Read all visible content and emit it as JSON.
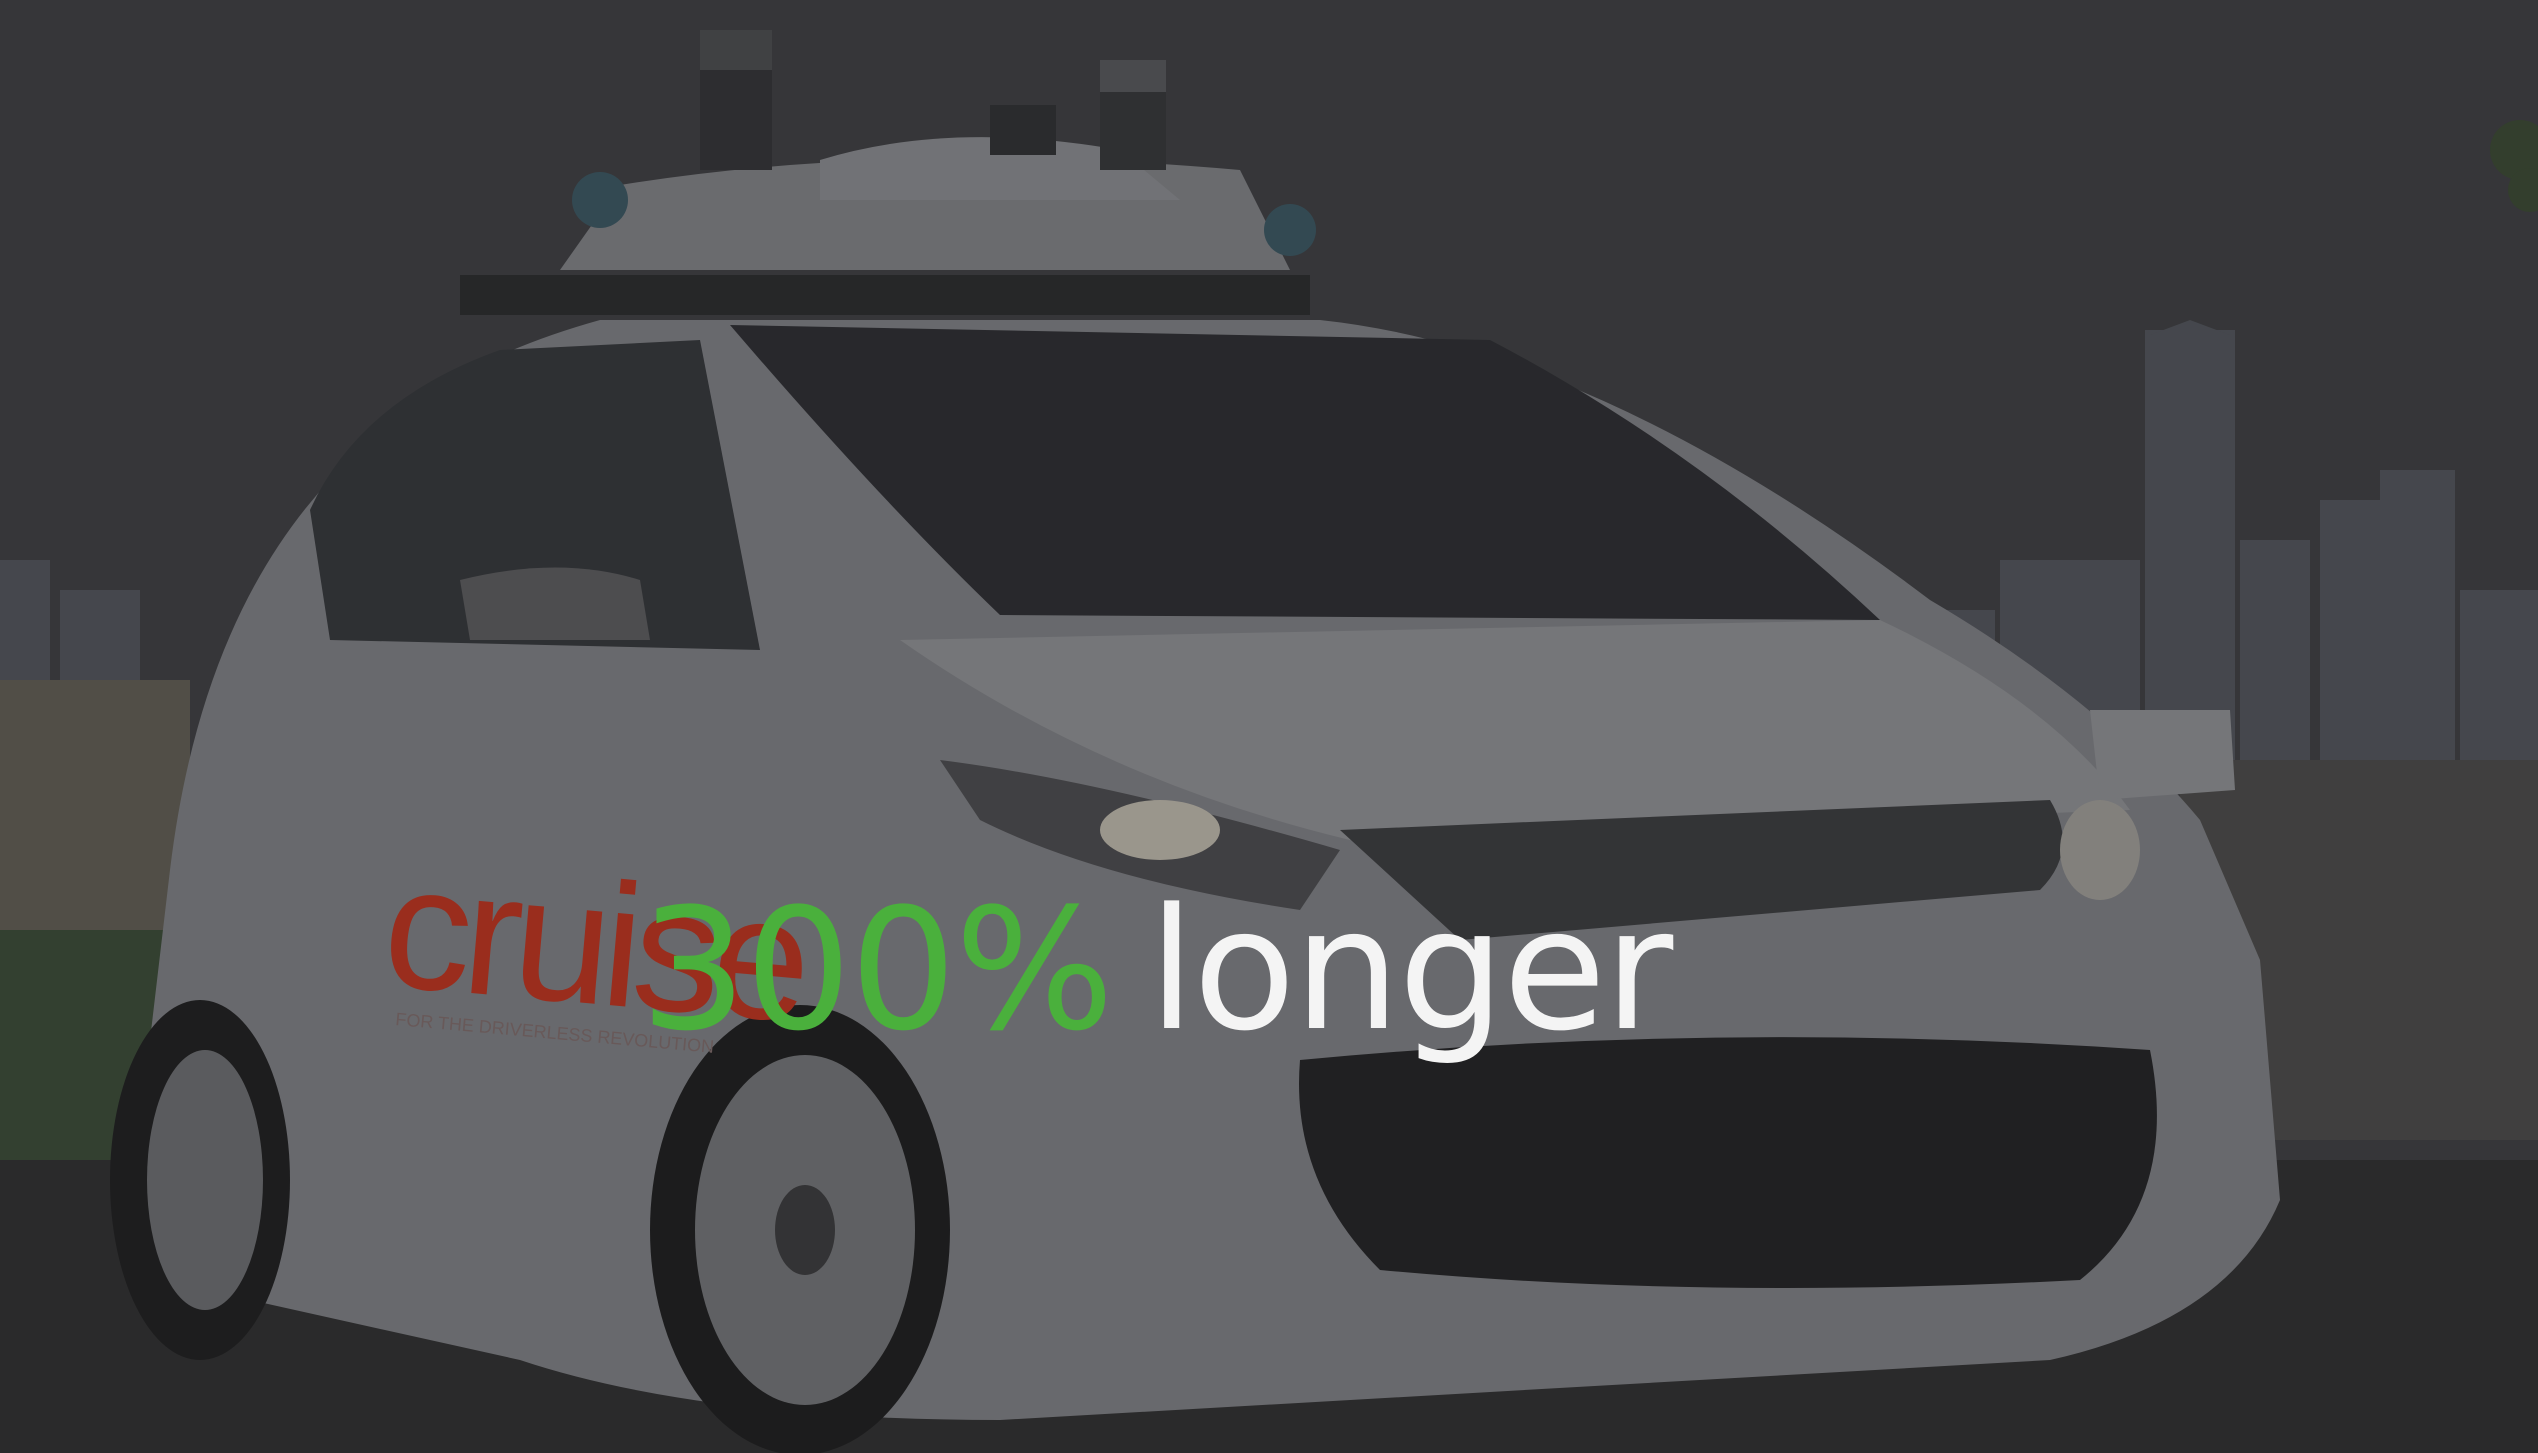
{
  "slide": {
    "headline_number": "300%",
    "headline_text": "longer",
    "brand_logo_text": "cruise",
    "brand_tagline": "FOR THE DRIVERLESS REVOLUTION"
  },
  "colors": {
    "accent_green": "#4ab03c",
    "headline_white": "#f4f4f4",
    "logo_red": "#b8321f",
    "background_dark": "#3d3e41"
  },
  "icons": {
    "lidar": "lidar-sensor-icon"
  }
}
